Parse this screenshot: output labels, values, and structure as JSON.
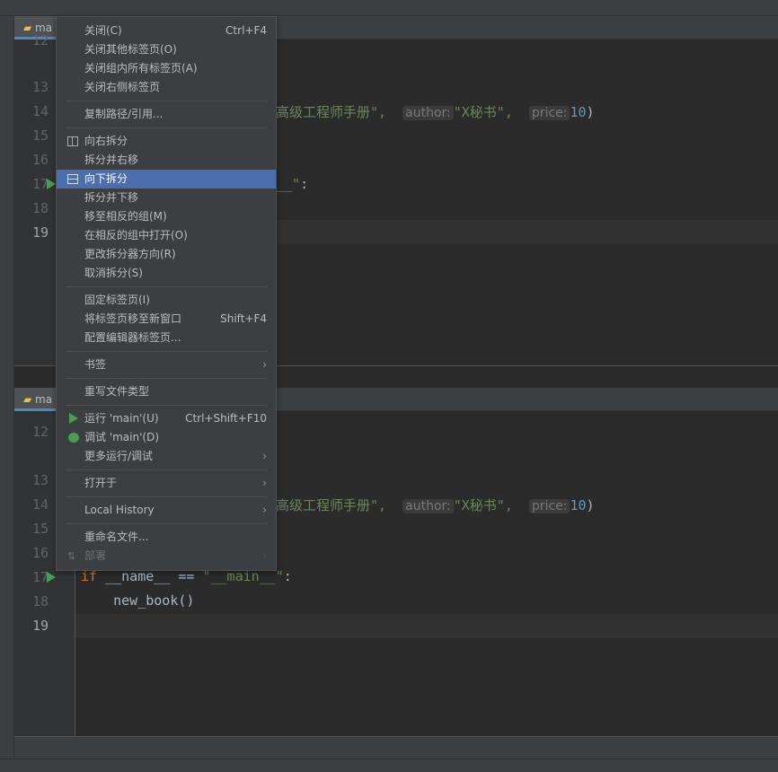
{
  "top_pane": {
    "tab_label": "ma",
    "line_numbers": [
      "12",
      "13",
      "14",
      "15",
      "16",
      "17",
      "18",
      "19"
    ],
    "line14_visible": {
      "str": "高级工程师手册\",",
      "hint_author": "author:",
      "author_val": "\"X秘书\",",
      "hint_price": "price:",
      "price_val": "10",
      ")": ")"
    },
    "line17_visible": {
      "str": "__\"",
      ":": ":"
    }
  },
  "bottom_pane": {
    "tab_label": "ma",
    "line_numbers": [
      "12",
      "13",
      "14",
      "15",
      "16",
      "17",
      "18",
      "19"
    ],
    "line14_visible": {
      "str": "高级工程师手册\",",
      "hint_author": "author:",
      "author_val": "\"X秘书\",",
      "hint_price": "price:",
      "price_val": "10",
      ")": ")"
    },
    "line17": {
      "kw": "if",
      "mid": " __name__ == ",
      "str": "\"__main__\"",
      "colon": ":"
    },
    "line18": "    new_book()"
  },
  "menu": {
    "close": "关闭(C)",
    "close_sc": "Ctrl+F4",
    "close_others": "关闭其他标签页(O)",
    "close_all_group": "关闭组内所有标签页(A)",
    "close_right": "关闭右侧标签页",
    "copy_path": "复制路径/引用...",
    "split_right": "向右拆分",
    "split_move_right": "拆分并右移",
    "split_down": "向下拆分",
    "split_move_down": "拆分并下移",
    "move_opposite": "移至相反的组(M)",
    "open_opposite": "在相反的组中打开(O)",
    "change_orientation": "更改拆分器方向(R)",
    "unsplit": "取消拆分(S)",
    "pin_tab": "固定标签页(I)",
    "move_new_window": "将标签页移至新窗口",
    "move_new_window_sc": "Shift+F4",
    "config_tabs": "配置编辑器标签页...",
    "bookmarks": "书签",
    "override_type": "重写文件类型",
    "run": "运行 'main'(U)",
    "run_sc": "Ctrl+Shift+F10",
    "debug": "调试 'main'(D)",
    "more_run": "更多运行/调试",
    "open_in": "打开于",
    "local_history": "Local History",
    "rename": "重命名文件...",
    "deploy": "部署"
  },
  "colors": {
    "selection": "#4b6eaf",
    "run_green": "#499c54",
    "string": "#6a8759",
    "keyword": "#cc7832",
    "number": "#6897bb"
  }
}
